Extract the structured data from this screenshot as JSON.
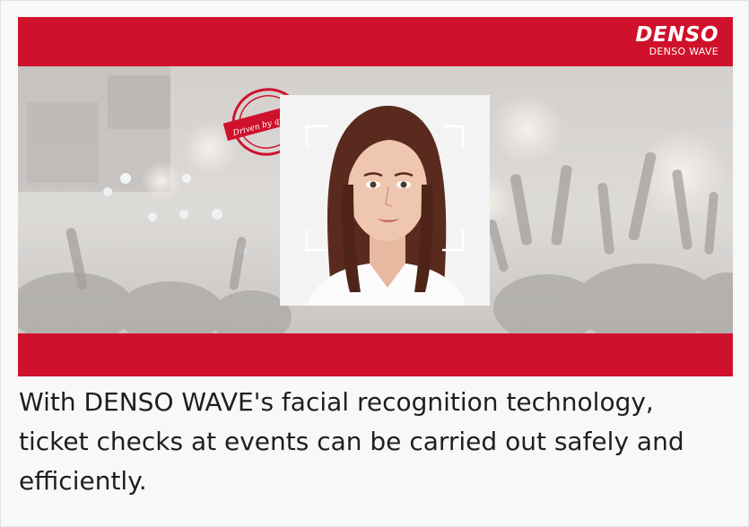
{
  "banner": {
    "logo": {
      "brand": "DENSO",
      "subbrand": "DENSO WAVE"
    },
    "stamp": {
      "text": "Driven by quality."
    },
    "background_image": "concert-crowd-photo",
    "photo": "woman-portrait-photo",
    "colors": {
      "brand_red": "#d0112b",
      "scan_frame": "#ffffff"
    }
  },
  "caption": {
    "text": "With DENSO WAVE's facial recognition technology, ticket checks at events can be carried out safely and efficiently."
  }
}
